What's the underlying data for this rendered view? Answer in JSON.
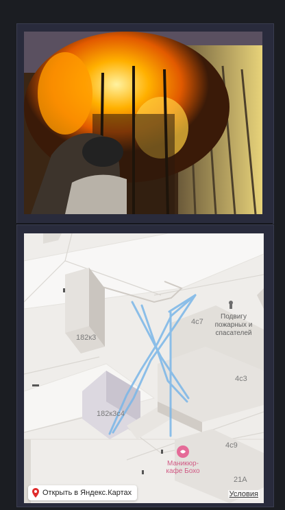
{
  "media": {
    "photo_icon": "fire-photo",
    "map": {
      "building_labels": [
        "182к3",
        "182к3с4",
        "4с7",
        "4с3",
        "4с9",
        "21А"
      ],
      "poi_label": "Подвигу пожарных и спасателей",
      "cafe_label": "Маникюр-кафе Бохо",
      "open_button_label": "Открыть в Яндекс.Картах",
      "terms_label": "Условия",
      "route_color": "#7ab6e8",
      "cafe_color": "#e56b98"
    }
  }
}
